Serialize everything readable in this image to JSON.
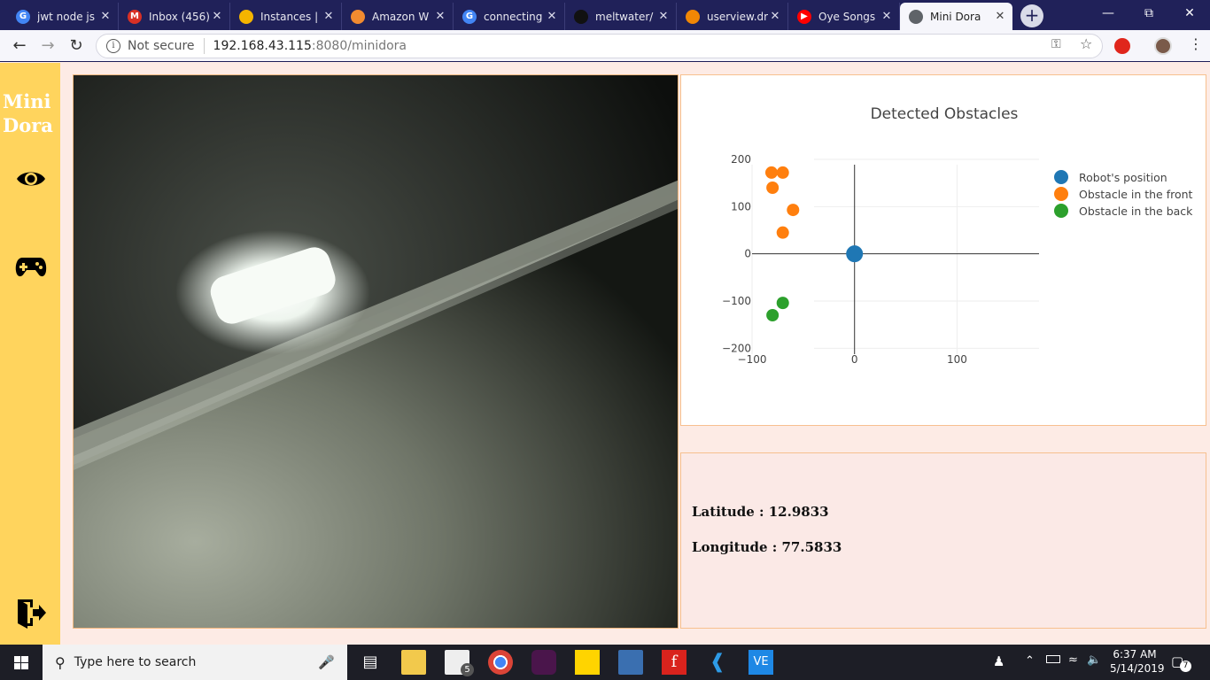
{
  "browser": {
    "tabs": [
      {
        "title": "jwt node js",
        "icon": "google-icon",
        "color": "#4285f4",
        "glyph": "G"
      },
      {
        "title": "Inbox (456)",
        "icon": "gmail-icon",
        "color": "#d93025",
        "glyph": "M"
      },
      {
        "title": "Instances | ",
        "icon": "aws-instances-icon",
        "color": "#f4b400",
        "glyph": ""
      },
      {
        "title": "Amazon W",
        "icon": "aws-box-icon",
        "color": "#f28b30",
        "glyph": ""
      },
      {
        "title": "connecting",
        "icon": "google-icon",
        "color": "#4285f4",
        "glyph": "G"
      },
      {
        "title": "meltwater/",
        "icon": "github-icon",
        "color": "#111111",
        "glyph": ""
      },
      {
        "title": "userview.dr",
        "icon": "drawio-icon",
        "color": "#f08705",
        "glyph": ""
      },
      {
        "title": "Oye Songs",
        "icon": "youtube-icon",
        "color": "#ff0000",
        "glyph": "▶"
      },
      {
        "title": "Mini Dora",
        "icon": "page-icon",
        "color": "#5f6368",
        "glyph": ""
      }
    ],
    "url_security": "Not secure",
    "url_host": "192.168.43.115",
    "url_path": ":8080/minidora"
  },
  "sidebar": {
    "logo_line1": "Mini",
    "logo_line2": "Dora",
    "items": [
      {
        "name": "view-camera",
        "icon": "eye-icon"
      },
      {
        "name": "controller",
        "icon": "gamepad-icon"
      },
      {
        "name": "logout",
        "icon": "logout-icon"
      }
    ]
  },
  "chart_data": {
    "type": "scatter",
    "title": "Detected Obstacles",
    "xlim": [
      -100,
      180
    ],
    "ylim": [
      -220,
      200
    ],
    "x_ticks": [
      -100,
      0,
      100
    ],
    "y_ticks": [
      200,
      100,
      0,
      -100,
      -200
    ],
    "x_tick_labels": [
      "−100",
      "0",
      "100"
    ],
    "y_tick_labels": [
      "200",
      "100",
      "0",
      "−100",
      "−200"
    ],
    "grid": true,
    "legend_position": "top-right",
    "series": [
      {
        "name": "Robot's position",
        "color": "#1f77b4",
        "x": [
          0
        ],
        "y": [
          0
        ],
        "size": "large"
      },
      {
        "name": "Obstacle in the front",
        "color": "#ff7f0e",
        "x": [
          -81,
          -70,
          -80,
          -60,
          -70
        ],
        "y": [
          172,
          172,
          140,
          93,
          45
        ],
        "size": "normal"
      },
      {
        "name": "Obstacle in the back",
        "color": "#2ca02c",
        "x": [
          -70,
          -80
        ],
        "y": [
          -104,
          -130
        ],
        "size": "normal"
      }
    ]
  },
  "gps": {
    "latitude_label": "Latitude : 12.9833",
    "longitude_label": "Longitude : 77.5833"
  },
  "taskbar": {
    "search_placeholder": "Type here to search",
    "time": "6:37 AM",
    "date": "5/14/2019",
    "mail_badge": "5",
    "notification_count": "7"
  }
}
